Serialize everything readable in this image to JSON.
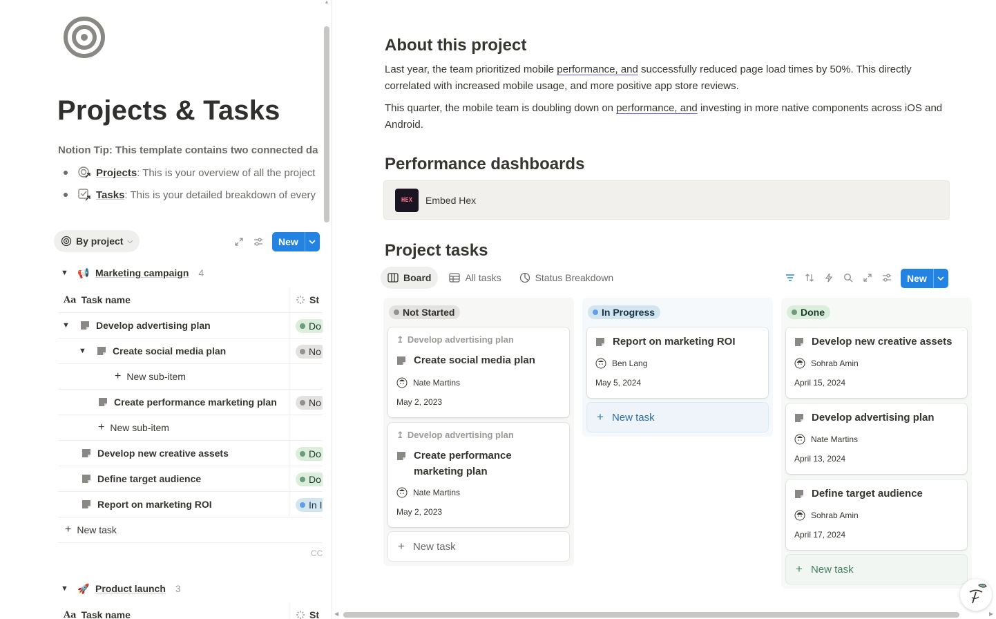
{
  "left": {
    "page_title": "Projects & Tasks",
    "tip": "Notion Tip: This template contains two connected da",
    "bullets": [
      {
        "link": "Projects",
        "rest": ": This is your overview of all the project"
      },
      {
        "link": "Tasks",
        "rest": ": This is your detailed breakdown of every"
      }
    ],
    "view_label": "By project",
    "new_label": "New",
    "groups": [
      {
        "name": "Marketing campaign",
        "count": "4",
        "emoji": "📢"
      },
      {
        "name": "Product launch",
        "count": "3",
        "emoji": "🚀"
      }
    ],
    "table_header": {
      "aa": "Aa",
      "name": "Task name",
      "status": "St"
    },
    "rows": [
      {
        "name": "Develop advertising plan",
        "status": "Do"
      },
      {
        "name": "Create social media plan",
        "status": "No"
      },
      {
        "name": "New sub-item",
        "status": ""
      },
      {
        "name": "Create performance marketing plan",
        "status": "No"
      },
      {
        "name": "New sub-item",
        "status": ""
      },
      {
        "name": "Develop new creative assets",
        "status": "Do"
      },
      {
        "name": "Define target audience",
        "status": "Do"
      },
      {
        "name": "Report on marketing ROI",
        "status": "In I"
      }
    ],
    "new_task": "New task",
    "calc": "CC"
  },
  "right": {
    "about_heading": "About this project",
    "para1_a": "Last year, the team prioritized mobile ",
    "para1_link": "performance, and",
    "para1_b": " successfully reduced page load times by 50%. This directly correlated with increased mobile usage, and more positive app store reviews.",
    "para2_a": "This quarter, the mobile team is doubling down on ",
    "para2_link": "performance, and",
    "para2_b": " investing in more native components across iOS and Android.",
    "dash_heading": "Performance dashboards",
    "embed_logo": "HEX",
    "embed_label": "Embed Hex",
    "tasks_heading": "Project tasks",
    "tabs": [
      "Board",
      "All tasks",
      "Status Breakdown"
    ],
    "new_label": "New",
    "columns": {
      "not_started": {
        "label": "Not Started",
        "cards": [
          {
            "parent": "Develop advertising plan",
            "title": "Create social media plan",
            "person": "Nate Martins",
            "date": "May 2, 2023"
          },
          {
            "parent": "Develop advertising plan",
            "title": "Create performance marketing plan",
            "person": "Nate Martins",
            "date": "May 2, 2023"
          }
        ],
        "new_task": "New task"
      },
      "in_progress": {
        "label": "In Progress",
        "cards": [
          {
            "title": "Report on marketing ROI",
            "person": "Ben Lang",
            "date": "May 5, 2024"
          }
        ],
        "new_task": "New task"
      },
      "done": {
        "label": "Done",
        "cards": [
          {
            "title": "Develop new creative assets",
            "person": "Sohrab Amin",
            "date": "April 15, 2024"
          },
          {
            "title": "Develop advertising plan",
            "person": "Nate Martins",
            "date": "April 13, 2024"
          },
          {
            "title": "Define target audience",
            "person": "Sohrab Amin",
            "date": "April 17, 2024"
          }
        ],
        "new_task": "New task"
      }
    }
  },
  "colors": {
    "accent": "#2383e2",
    "done_dot": "#6c9b7d",
    "not_started_dot": "#91918e",
    "in_progress_dot": "#5e9fe8"
  }
}
